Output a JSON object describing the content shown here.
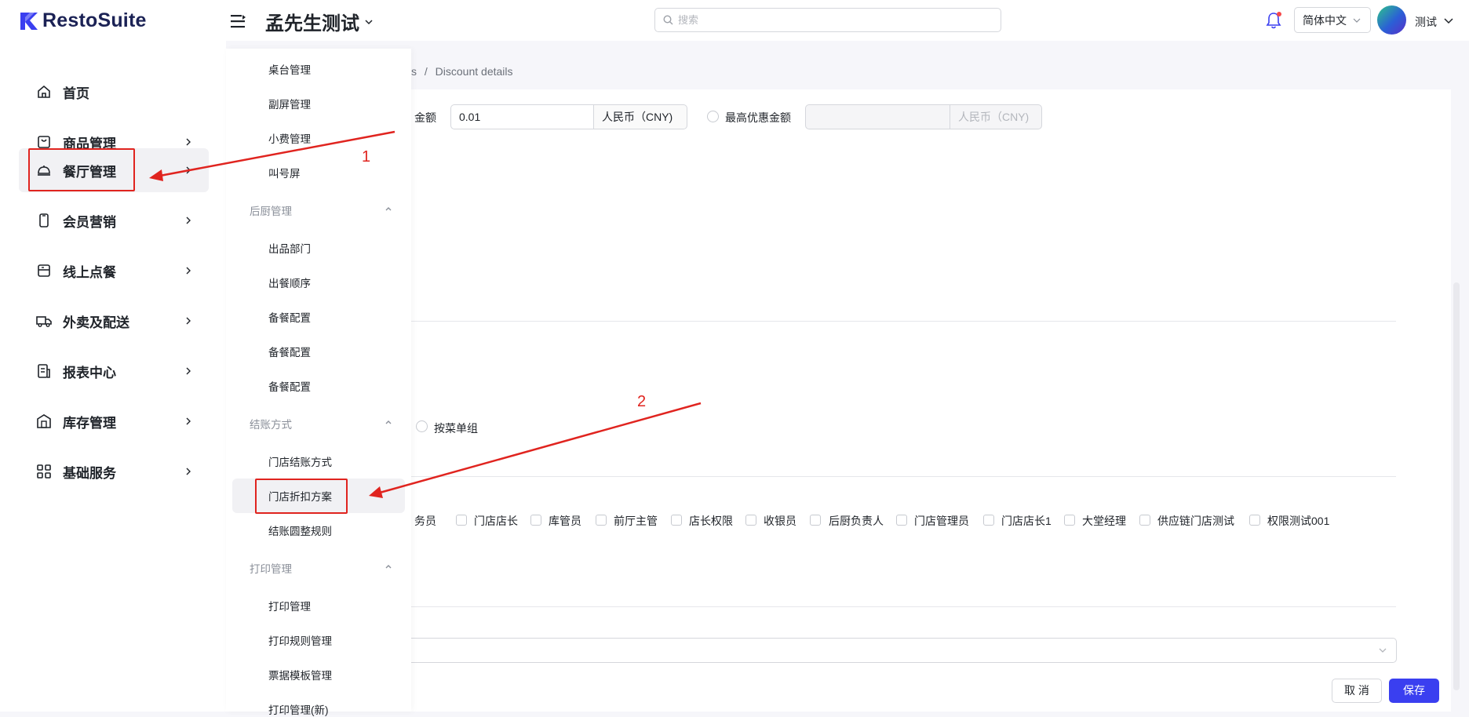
{
  "header": {
    "brand": "RestoSuite",
    "store_name": "孟先生测试",
    "search_placeholder": "搜索",
    "language": "简体中文",
    "user": "测试",
    "colors": {
      "brand": "#3a3ff0",
      "notification_dot": "#f5484a"
    }
  },
  "sidebar": {
    "items": [
      {
        "label": "首页",
        "icon": "home-icon"
      },
      {
        "label": "商品管理",
        "icon": "shopping-bag-icon"
      },
      {
        "label": "餐厅管理",
        "icon": "cloche-icon",
        "active": true
      },
      {
        "label": "会员营销",
        "icon": "mobile-icon"
      },
      {
        "label": "线上点餐",
        "icon": "online-order-icon"
      },
      {
        "label": "外卖及配送",
        "icon": "truck-icon"
      },
      {
        "label": "报表中心",
        "icon": "report-icon"
      },
      {
        "label": "库存管理",
        "icon": "warehouse-icon"
      },
      {
        "label": "基础服务",
        "icon": "grid-icon"
      }
    ]
  },
  "submenu": {
    "items_top": [
      "桌台管理",
      "副屏管理",
      "小费管理",
      "叫号屏"
    ],
    "group_kitchen": {
      "title": "后厨管理",
      "items": [
        "出品部门",
        "出餐顺序",
        "备餐配置",
        "备餐配置",
        "备餐配置"
      ]
    },
    "group_checkout": {
      "title": "结账方式",
      "items": [
        "门店结账方式",
        "门店折扣方案",
        "结账圆整规则"
      ],
      "active": "门店折扣方案"
    },
    "group_print": {
      "title": "打印管理",
      "items": [
        "打印管理",
        "打印规则管理",
        "票据模板管理",
        "打印管理(新)"
      ]
    }
  },
  "content": {
    "breadcrumb_partial": "s",
    "breadcrumb_sep": "/",
    "breadcrumb_current": "Discount details",
    "amount_label_partial": "金额",
    "amount_value": "0.01",
    "currency": "人民币（CNY)",
    "max_discount_label": "最高优惠金额",
    "max_currency": "人民币（CNY)",
    "by_group_label": "按菜单组",
    "roles": [
      "务员",
      "门店店长",
      "库管员",
      "前厅主管",
      "店长权限",
      "收银员",
      "后厨负责人",
      "门店管理员",
      "门店店长1",
      "大堂经理",
      "供应链门店测试",
      "权限测试001"
    ],
    "cancel": "取 消",
    "save": "保存"
  },
  "annotations": {
    "step1": "1",
    "step2": "2",
    "color": "#e0241f"
  }
}
